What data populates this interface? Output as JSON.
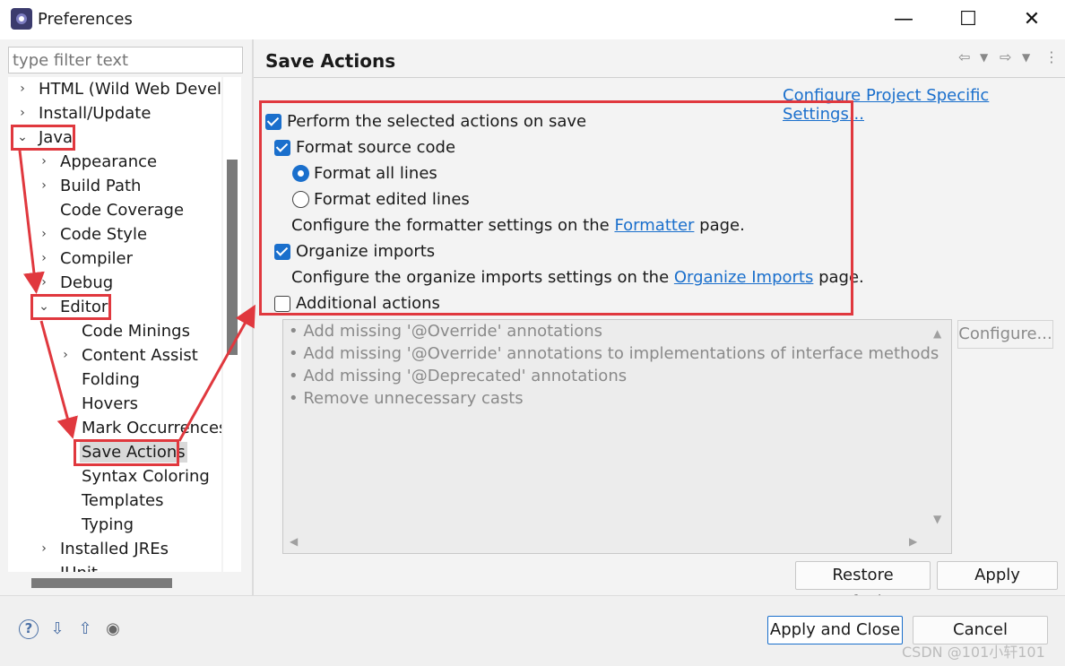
{
  "window": {
    "title": "Preferences",
    "minimize": "—",
    "maximize": "☐",
    "close": "✕"
  },
  "filter": {
    "placeholder": "type filter text"
  },
  "tree": {
    "html": "HTML (Wild Web Develc",
    "install_update": "Install/Update",
    "java": "Java",
    "appearance": "Appearance",
    "build_path": "Build Path",
    "code_coverage": "Code Coverage",
    "code_style": "Code Style",
    "compiler": "Compiler",
    "debug": "Debug",
    "editor": "Editor",
    "code_minings": "Code Minings",
    "content_assist": "Content Assist",
    "folding": "Folding",
    "hovers": "Hovers",
    "mark_occurrences": "Mark Occurrences",
    "save_actions": "Save Actions",
    "syntax_coloring": "Syntax Coloring",
    "templates": "Templates",
    "typing": "Typing",
    "installed_jres": "Installed JREs",
    "junit": "JUnit",
    "collapsed_glyph": "›",
    "expanded_glyph": "⌄"
  },
  "page": {
    "title": "Save Actions",
    "configure_link": "Configure Project Specific Settings...",
    "perform_on_save": {
      "label": "Perform the selected actions on save",
      "checked": true
    },
    "format_source": {
      "label": "Format source code",
      "checked": true
    },
    "format_all": {
      "label": "Format all lines",
      "selected": true
    },
    "format_edited": {
      "label": "Format edited lines",
      "selected": false
    },
    "formatter_text_pre": "Configure the formatter settings on the ",
    "formatter_link": "Formatter",
    "formatter_text_post": " page.",
    "organize_imports": {
      "label": "Organize imports",
      "checked": true
    },
    "organize_text_pre": "Configure the organize imports settings on the ",
    "organize_link": "Organize Imports",
    "organize_text_post": " page.",
    "additional_actions": {
      "label": "Additional actions",
      "checked": false
    },
    "additional_items": [
      "Add missing '@Override' annotations",
      "Add missing '@Override' annotations to implementations of interface methods",
      "Add missing '@Deprecated' annotations",
      "Remove unnecessary casts"
    ],
    "configure_button": "Configure...",
    "restore_defaults": "Restore Defaults",
    "apply": "Apply"
  },
  "footer": {
    "apply_and_close": "Apply and Close",
    "cancel": "Cancel",
    "help_icon": "?",
    "import_icon": "⇩",
    "export_icon": "⇧",
    "record_icon": "◉"
  },
  "watermark": "CSDN @101小轩101",
  "colors": {
    "accent": "#1a6fcc",
    "annotation_red": "#e0383e"
  }
}
